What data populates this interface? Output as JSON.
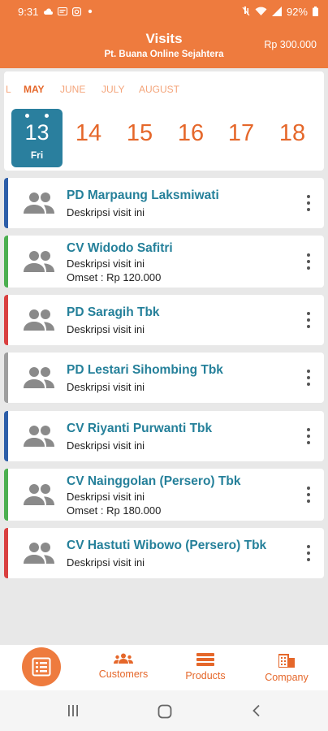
{
  "status_bar": {
    "time": "9:31",
    "battery": "92%",
    "icons": [
      "cloud-icon",
      "message-icon",
      "instagram-icon",
      "dot-icon",
      "mute-icon",
      "wifi-icon",
      "signal-icon",
      "battery-icon"
    ]
  },
  "header": {
    "title": "Visits",
    "subtitle": "Pt. Buana Online Sejahtera",
    "amount": "Rp 300.000"
  },
  "calendar": {
    "months": [
      "L",
      "MAY",
      "JUNE",
      "JULY",
      "AUGUST"
    ],
    "active_month": "MAY",
    "selected_day": {
      "number": "13",
      "weekday": "Fri"
    },
    "days": [
      "14",
      "15",
      "16",
      "17",
      "18"
    ]
  },
  "visits": [
    {
      "name": "PD Marpaung Laksmiwati",
      "description": "Deskripsi visit ini",
      "omset": "",
      "color": "#2d5ea8"
    },
    {
      "name": "CV Widodo Safitri",
      "description": "Deskripsi visit ini",
      "omset": "Omset : Rp 120.000",
      "color": "#4caf50"
    },
    {
      "name": "PD Saragih Tbk",
      "description": "Deskripsi visit ini",
      "omset": "",
      "color": "#d94040"
    },
    {
      "name": "PD Lestari Sihombing Tbk",
      "description": "Deskripsi visit ini",
      "omset": "",
      "color": "#9e9e9e"
    },
    {
      "name": "CV Riyanti Purwanti Tbk",
      "description": "Deskripsi visit ini",
      "omset": "",
      "color": "#2d5ea8"
    },
    {
      "name": "CV Nainggolan (Persero) Tbk",
      "description": "Deskripsi visit ini",
      "omset": "Omset : Rp 180.000",
      "color": "#4caf50"
    },
    {
      "name": "CV Hastuti Wibowo (Persero) Tbk",
      "description": "Deskripsi visit ini",
      "omset": "",
      "color": "#d94040"
    }
  ],
  "bottom_nav": {
    "fab_icon": "list-icon",
    "items": [
      {
        "label": "Customers",
        "icon": "customers-icon"
      },
      {
        "label": "Products",
        "icon": "products-icon"
      },
      {
        "label": "Company",
        "icon": "company-icon"
      }
    ]
  },
  "colors": {
    "primary": "#ee7b3e",
    "accent_text": "#e5672a",
    "selected_day": "#2a7f9e",
    "visit_name": "#25809a"
  }
}
